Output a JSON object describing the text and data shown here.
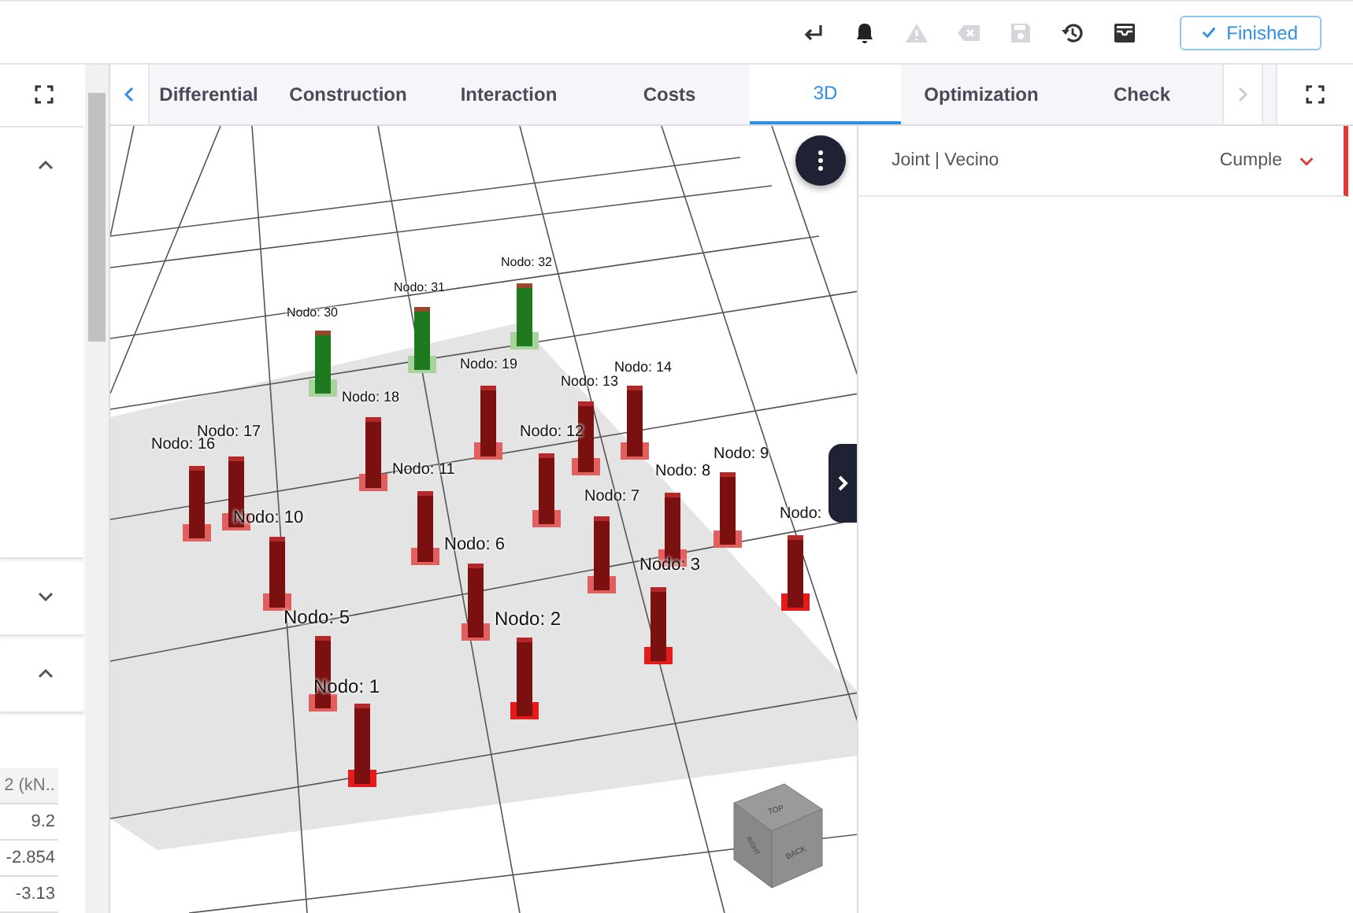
{
  "toolbar": {
    "finished_button": {
      "label": "Finished",
      "checked": true
    }
  },
  "left_panel": {
    "table": {
      "header": "2 (kN..",
      "values": [
        "9.2",
        "-2.854",
        "-3.13"
      ]
    }
  },
  "tabs": [
    {
      "label": "Differential",
      "selected": false
    },
    {
      "label": "Construction",
      "selected": false
    },
    {
      "label": "Interaction",
      "selected": false
    },
    {
      "label": "Costs",
      "selected": false
    },
    {
      "label": "3D",
      "selected": true
    },
    {
      "label": "Optimization",
      "selected": false
    },
    {
      "label": "Check",
      "selected": false
    }
  ],
  "viewport": {
    "nodes": [
      {
        "label": "Nodo: 30",
        "color": "#1f7a1f"
      },
      {
        "label": "Nodo: 31",
        "color": "#1f7a1f"
      },
      {
        "label": "Nodo: 32",
        "color": "#1f7a1f"
      },
      {
        "label": "Nodo: 19",
        "color": "#7a1010"
      },
      {
        "label": "Nodo: 18",
        "color": "#7a1010"
      },
      {
        "label": "Nodo: 13",
        "color": "#7a1010"
      },
      {
        "label": "Nodo: 14",
        "color": "#7a1010"
      },
      {
        "label": "Nodo: 17",
        "color": "#7a1010"
      },
      {
        "label": "Nodo: 16",
        "color": "#7a1010"
      },
      {
        "label": "Nodo: 12",
        "color": "#7a1010"
      },
      {
        "label": "Nodo: 11",
        "color": "#7a1010"
      },
      {
        "label": "Nodo: 9",
        "color": "#7a1010"
      },
      {
        "label": "Nodo: 8",
        "color": "#7a1010"
      },
      {
        "label": "Nodo: 10",
        "color": "#7a1010"
      },
      {
        "label": "Nodo: 7",
        "color": "#7a1010"
      },
      {
        "label": "Nodo: 6",
        "color": "#7a1010"
      },
      {
        "label": "Nodo: 3",
        "color": "#7a1010"
      },
      {
        "label": "Nodo: 5",
        "color": "#7a1010"
      },
      {
        "label": "Nodo: 2",
        "color": "#7a1010"
      },
      {
        "label": "Nodo: 1",
        "color": "#7a1010"
      },
      {
        "label": "Nodo:",
        "color": "#7a1010"
      }
    ],
    "cube": {
      "top": "TOP",
      "left": "RIGHT",
      "front": "BACK"
    }
  },
  "right_panel": {
    "rows": [
      {
        "label": "Joint | Vecino",
        "status": "Cumple",
        "expanded": false
      }
    ]
  }
}
